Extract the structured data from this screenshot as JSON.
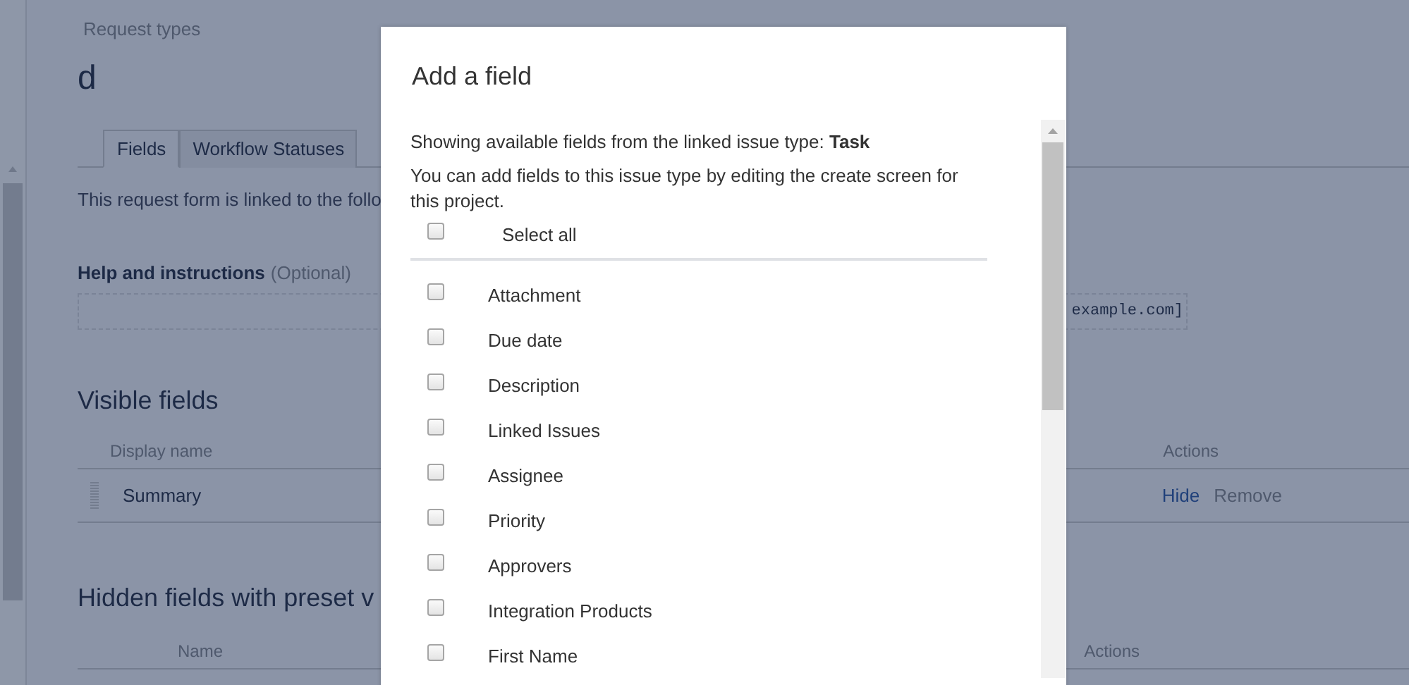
{
  "page": {
    "breadcrumb": "Request types",
    "title": "d",
    "tabs": [
      {
        "label": "Fields",
        "selected": true
      },
      {
        "label": "Workflow Statuses",
        "selected": false
      }
    ],
    "intro": "This request form is linked to the follo",
    "help": {
      "label": "Help and instructions",
      "note": "(Optional)",
      "value": "example.com]"
    },
    "visible_fields": {
      "heading": "Visible fields",
      "columns": [
        "Display name",
        "Actions"
      ],
      "rows": [
        {
          "name": "Summary",
          "actions": [
            {
              "label": "Hide",
              "kind": "link"
            },
            {
              "label": "Remove",
              "kind": "muted"
            }
          ]
        }
      ]
    },
    "hidden_fields": {
      "heading": "Hidden fields with preset v",
      "columns": [
        "Name",
        "Actions"
      ]
    }
  },
  "dialog": {
    "title": "Add a field",
    "source_text": "Showing available fields from the linked issue type: **Task**",
    "hint": "You can add fields to this issue type by editing the create screen for this project.",
    "select_all": {
      "label": "Select all",
      "checked": false
    },
    "fields": [
      {
        "label": "Attachment",
        "checked": false
      },
      {
        "label": "Due date",
        "checked": false
      },
      {
        "label": "Description",
        "checked": false
      },
      {
        "label": "Linked Issues",
        "checked": false
      },
      {
        "label": "Assignee",
        "checked": false
      },
      {
        "label": "Priority",
        "checked": false
      },
      {
        "label": "Approvers",
        "checked": false
      },
      {
        "label": "Integration Products",
        "checked": false
      },
      {
        "label": "First Name",
        "checked": false
      }
    ]
  }
}
